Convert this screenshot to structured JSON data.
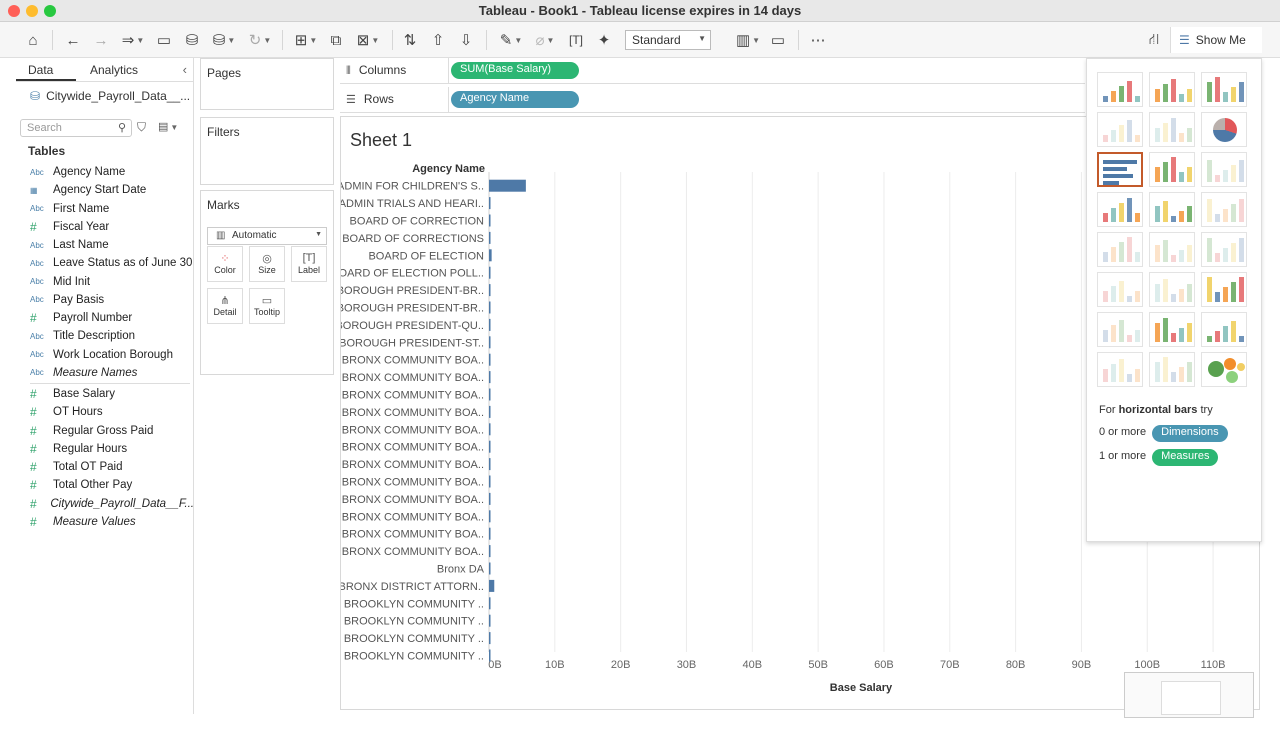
{
  "window": {
    "title": "Tableau - Book1 - Tableau license expires in 14 days"
  },
  "toolbar": {
    "mark_size": "Standard",
    "show_me": "Show Me"
  },
  "data_pane": {
    "tabs": [
      "Data",
      "Analytics"
    ],
    "datasource": "Citywide_Payroll_Data__...",
    "search_placeholder": "Search",
    "tables_heading": "Tables",
    "dimensions": [
      {
        "type": "Abc",
        "name": "Agency Name"
      },
      {
        "type": "date",
        "name": "Agency Start Date"
      },
      {
        "type": "Abc",
        "name": "First Name"
      },
      {
        "type": "#",
        "name": "Fiscal Year"
      },
      {
        "type": "Abc",
        "name": "Last Name"
      },
      {
        "type": "Abc",
        "name": "Leave Status as of June 30"
      },
      {
        "type": "Abc",
        "name": "Mid Init"
      },
      {
        "type": "Abc",
        "name": "Pay Basis"
      },
      {
        "type": "#",
        "name": "Payroll Number"
      },
      {
        "type": "Abc",
        "name": "Title Description"
      },
      {
        "type": "Abc",
        "name": "Work Location Borough"
      },
      {
        "type": "Abc",
        "name": "Measure Names",
        "italic": true
      }
    ],
    "measures": [
      {
        "type": "#",
        "name": "Base Salary"
      },
      {
        "type": "#",
        "name": "OT Hours"
      },
      {
        "type": "#",
        "name": "Regular Gross Paid"
      },
      {
        "type": "#",
        "name": "Regular Hours"
      },
      {
        "type": "#",
        "name": "Total OT Paid"
      },
      {
        "type": "#",
        "name": "Total Other Pay"
      },
      {
        "type": "#",
        "name": "Citywide_Payroll_Data__F...",
        "italic": true
      },
      {
        "type": "#",
        "name": "Measure Values",
        "italic": true
      }
    ]
  },
  "cards": {
    "pages": "Pages",
    "filters": "Filters",
    "marks": "Marks",
    "mark_type": "Automatic",
    "mark_buttons": [
      "Color",
      "Size",
      "Label",
      "Detail",
      "Tooltip"
    ]
  },
  "shelves": {
    "columns_label": "Columns",
    "rows_label": "Rows",
    "columns_pill": "SUM(Base Salary)",
    "rows_pill": "Agency Name"
  },
  "sheet": {
    "title": "Sheet 1"
  },
  "chart_data": {
    "type": "bar",
    "orientation": "horizontal",
    "row_header": "Agency Name",
    "xlabel": "Base Salary",
    "xlim": [
      0,
      115
    ],
    "x_unit": "B",
    "x_ticks": [
      "0B",
      "10B",
      "20B",
      "30B",
      "40B",
      "50B",
      "60B",
      "70B",
      "80B",
      "90B",
      "100B",
      "110B"
    ],
    "categories": [
      "ADMIN FOR CHILDREN'S S..",
      "ADMIN TRIALS AND HEARI..",
      "BOARD OF CORRECTION",
      "BOARD OF CORRECTIONS",
      "BOARD OF ELECTION",
      "BOARD OF ELECTION POLL..",
      "BOROUGH PRESIDENT-BR..",
      "BOROUGH PRESIDENT-BR..",
      "BOROUGH PRESIDENT-QU..",
      "BOROUGH PRESIDENT-ST..",
      "BRONX COMMUNITY BOA..",
      "BRONX COMMUNITY BOA..",
      "BRONX COMMUNITY BOA..",
      "BRONX COMMUNITY BOA..",
      "BRONX COMMUNITY BOA..",
      "BRONX COMMUNITY BOA..",
      "BRONX COMMUNITY BOA..",
      "BRONX COMMUNITY BOA..",
      "BRONX COMMUNITY BOA..",
      "BRONX COMMUNITY BOA..",
      "BRONX COMMUNITY BOA..",
      "BRONX COMMUNITY BOA..",
      "Bronx DA",
      "BRONX DISTRICT ATTORN..",
      "BROOKLYN COMMUNITY ..",
      "BROOKLYN COMMUNITY ..",
      "BROOKLYN COMMUNITY ..",
      "BROOKLYN COMMUNITY .."
    ],
    "values": [
      5.6,
      0.1,
      0.02,
      0.03,
      0.4,
      0.05,
      0.03,
      0.03,
      0.03,
      0.03,
      0.02,
      0.02,
      0.02,
      0.02,
      0.02,
      0.02,
      0.02,
      0.02,
      0.02,
      0.02,
      0.02,
      0.02,
      0.01,
      0.8,
      0.02,
      0.02,
      0.02,
      0.02
    ],
    "grid": true,
    "bar_color": "#4e79a7"
  },
  "show_me": {
    "hint_prefix": "For",
    "hint_chart": "horizontal bars",
    "hint_suffix": "try",
    "req1_prefix": "0 or more",
    "req1_pill": "Dimensions",
    "req2_prefix": "1 or more",
    "req2_pill": "Measures",
    "selected": "horizontal bars"
  },
  "colors": {
    "dimension_pill": "#4996b2",
    "measure_pill": "#2cb673",
    "accent_selected": "#c35a2a"
  }
}
